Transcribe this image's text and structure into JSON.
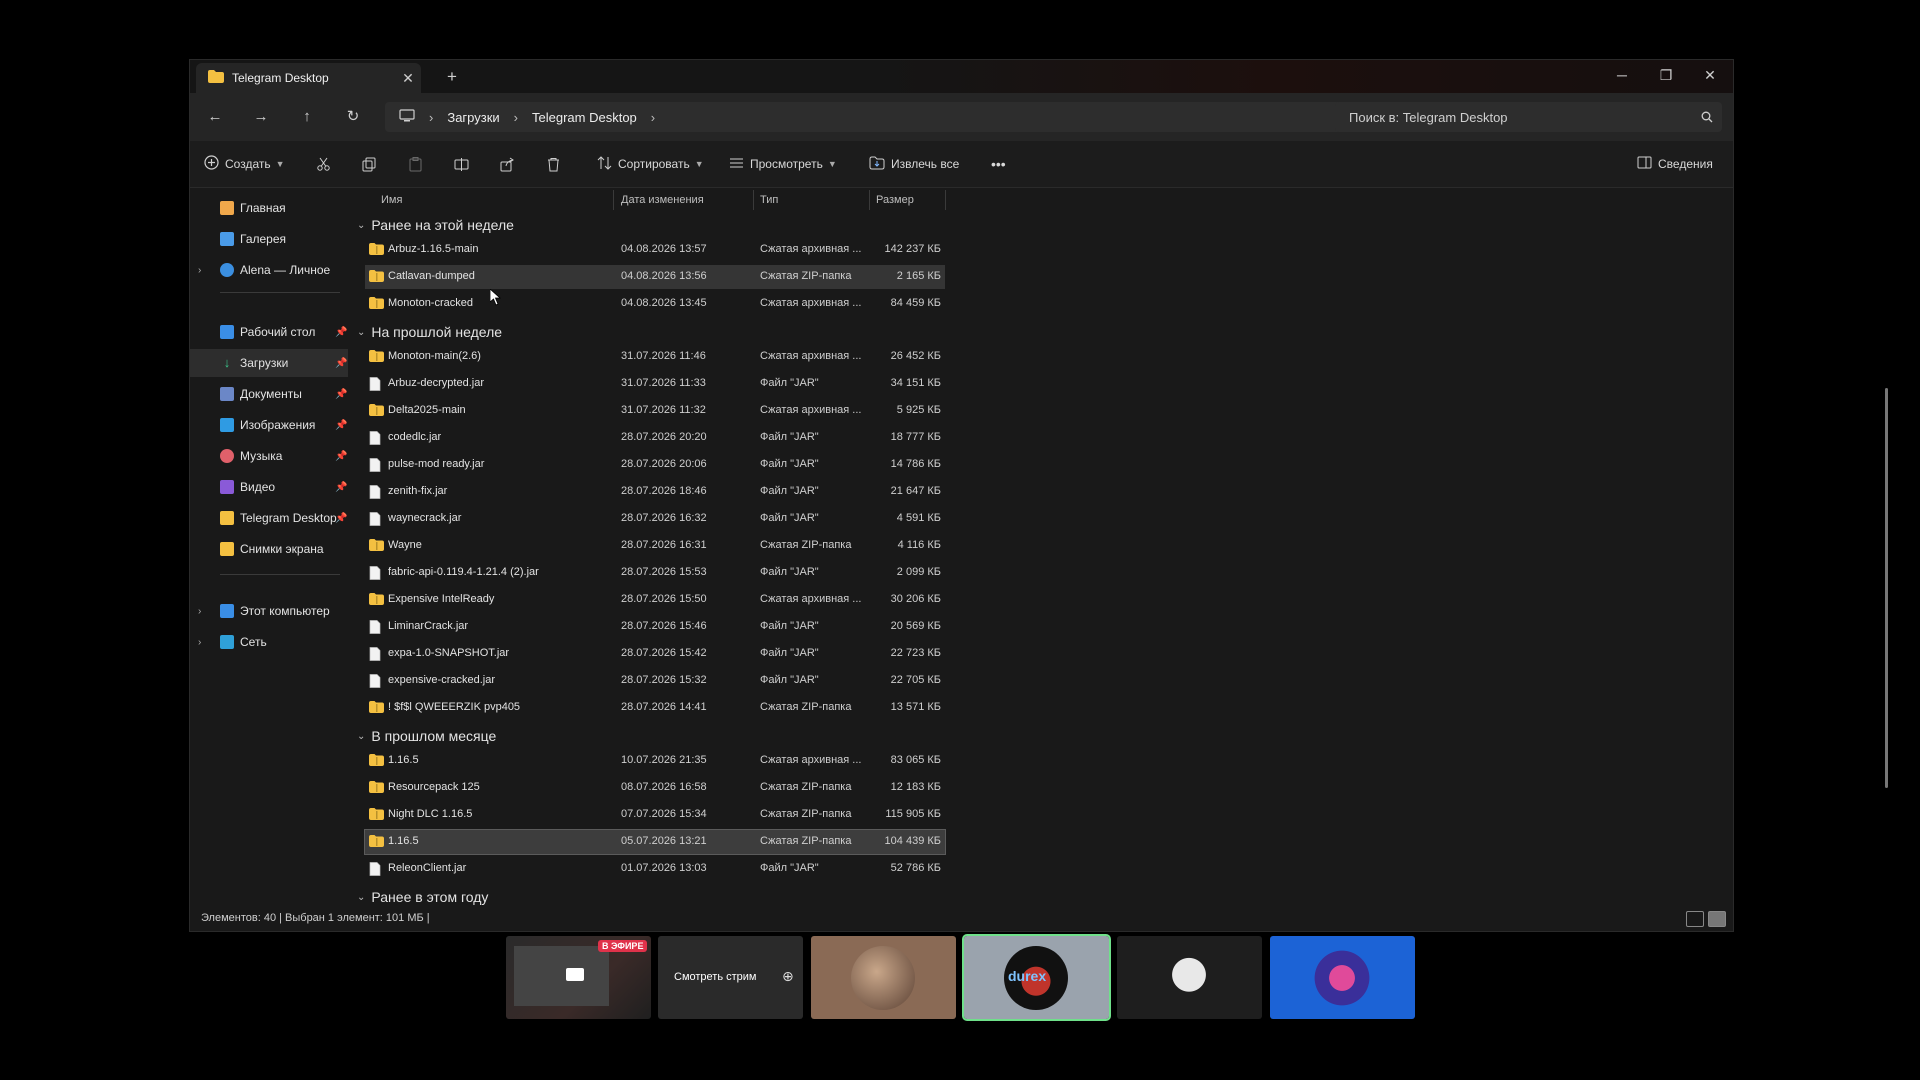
{
  "window": {
    "tab_title": "Telegram Desktop",
    "tab_close": "✕",
    "new_tab": "+",
    "controls": {
      "minimize": "─",
      "maximize": "❐",
      "close": "✕"
    }
  },
  "address": {
    "breadcrumb": [
      "Загрузки",
      "Telegram Desktop"
    ],
    "search_placeholder": "Поиск в: Telegram Desktop"
  },
  "toolbar": {
    "create": "Создать",
    "sort": "Сортировать",
    "view": "Просмотреть",
    "extract": "Извлечь все",
    "more": "•••",
    "details": "Сведения"
  },
  "sidebar": {
    "items": [
      {
        "label": "Главная",
        "icon": "home-icon"
      },
      {
        "label": "Галерея",
        "icon": "gallery-icon"
      },
      {
        "label": "Alena — Личное",
        "icon": "cloud-icon"
      },
      {
        "label": "Рабочий стол",
        "icon": "desktop-icon"
      },
      {
        "label": "Загрузки",
        "icon": "download-icon"
      },
      {
        "label": "Документы",
        "icon": "documents-icon"
      },
      {
        "label": "Изображения",
        "icon": "pictures-icon"
      },
      {
        "label": "Музыка",
        "icon": "music-icon"
      },
      {
        "label": "Видео",
        "icon": "video-icon"
      },
      {
        "label": "Telegram Desktop",
        "icon": "folder-icon"
      },
      {
        "label": "Снимки экрана",
        "icon": "folder-icon"
      },
      {
        "label": "Этот компьютер",
        "icon": "computer-icon"
      },
      {
        "label": "Сеть",
        "icon": "network-icon"
      }
    ]
  },
  "columns": {
    "name": "Имя",
    "date": "Дата изменения",
    "type": "Тип",
    "size": "Размер"
  },
  "groups": [
    {
      "title": "Ранее на этой неделе",
      "rows": [
        {
          "name": "Arbuz-1.16.5-main",
          "date": "04.08.2026 13:57",
          "type": "Сжатая архивная ...",
          "size": "142 237 КБ",
          "kind": "folder"
        },
        {
          "name": "Catlavan-dumped",
          "date": "04.08.2026 13:56",
          "type": "Сжатая ZIP-папка",
          "size": "2 165 КБ",
          "kind": "folder"
        },
        {
          "name": "Monoton-cracked",
          "date": "04.08.2026 13:45",
          "type": "Сжатая архивная ...",
          "size": "84 459 КБ",
          "kind": "folder"
        }
      ]
    },
    {
      "title": "На прошлой неделе",
      "rows": [
        {
          "name": "Monoton-main(2.6)",
          "date": "31.07.2026 11:46",
          "type": "Сжатая архивная ...",
          "size": "26 452 КБ",
          "kind": "folder"
        },
        {
          "name": "Arbuz-decrypted.jar",
          "date": "31.07.2026 11:33",
          "type": "Файл \"JAR\"",
          "size": "34 151 КБ",
          "kind": "file"
        },
        {
          "name": "Delta2025-main",
          "date": "31.07.2026 11:32",
          "type": "Сжатая архивная ...",
          "size": "5 925 КБ",
          "kind": "folder"
        },
        {
          "name": "codedlc.jar",
          "date": "28.07.2026 20:20",
          "type": "Файл \"JAR\"",
          "size": "18 777 КБ",
          "kind": "file"
        },
        {
          "name": "pulse-mod ready.jar",
          "date": "28.07.2026 20:06",
          "type": "Файл \"JAR\"",
          "size": "14 786 КБ",
          "kind": "file"
        },
        {
          "name": "zenith-fix.jar",
          "date": "28.07.2026 18:46",
          "type": "Файл \"JAR\"",
          "size": "21 647 КБ",
          "kind": "file"
        },
        {
          "name": "waynecrack.jar",
          "date": "28.07.2026 16:32",
          "type": "Файл \"JAR\"",
          "size": "4 591 КБ",
          "kind": "file"
        },
        {
          "name": "Wayne",
          "date": "28.07.2026 16:31",
          "type": "Сжатая ZIP-папка",
          "size": "4 116 КБ",
          "kind": "folder"
        },
        {
          "name": "fabric-api-0.119.4-1.21.4 (2).jar",
          "date": "28.07.2026 15:53",
          "type": "Файл \"JAR\"",
          "size": "2 099 КБ",
          "kind": "file"
        },
        {
          "name": "Expensive IntelReady",
          "date": "28.07.2026 15:50",
          "type": "Сжатая архивная ...",
          "size": "30 206 КБ",
          "kind": "folder"
        },
        {
          "name": "LiminarCrack.jar",
          "date": "28.07.2026 15:46",
          "type": "Файл \"JAR\"",
          "size": "20 569 КБ",
          "kind": "file"
        },
        {
          "name": "expa-1.0-SNAPSHOT.jar",
          "date": "28.07.2026 15:42",
          "type": "Файл \"JAR\"",
          "size": "22 723 КБ",
          "kind": "file"
        },
        {
          "name": "expensive-cracked.jar",
          "date": "28.07.2026 15:32",
          "type": "Файл \"JAR\"",
          "size": "22 705 КБ",
          "kind": "file"
        },
        {
          "name": "!      $f$l QWEEERZIK pvp405",
          "date": "28.07.2026 14:41",
          "type": "Сжатая ZIP-папка",
          "size": "13 571 КБ",
          "kind": "folder"
        }
      ]
    },
    {
      "title": "В прошлом месяце",
      "rows": [
        {
          "name": "1.16.5",
          "date": "10.07.2026 21:35",
          "type": "Сжатая архивная ...",
          "size": "83 065 КБ",
          "kind": "folder"
        },
        {
          "name": "Resourcepack 125",
          "date": "08.07.2026 16:58",
          "type": "Сжатая ZIP-папка",
          "size": "12 183 КБ",
          "kind": "folder"
        },
        {
          "name": "Night DLC 1.16.5",
          "date": "07.07.2026 15:34",
          "type": "Сжатая ZIP-папка",
          "size": "115 905 КБ",
          "kind": "folder"
        },
        {
          "name": "1.16.5",
          "date": "05.07.2026 13:21",
          "type": "Сжатая ZIP-папка",
          "size": "104 439 КБ",
          "kind": "folder"
        },
        {
          "name": "ReleonClient.jar",
          "date": "01.07.2026 13:03",
          "type": "Файл \"JAR\"",
          "size": "52 786 КБ",
          "kind": "file"
        }
      ]
    },
    {
      "title": "Ранее в этом году",
      "rows": []
    }
  ],
  "status": "Элементов: 40  |  Выбран 1 элемент: 101 МБ  |",
  "stream": {
    "live_badge": "В ЭФИРЕ",
    "watch_label": "Смотреть стрим",
    "avatar_text": "durex"
  }
}
